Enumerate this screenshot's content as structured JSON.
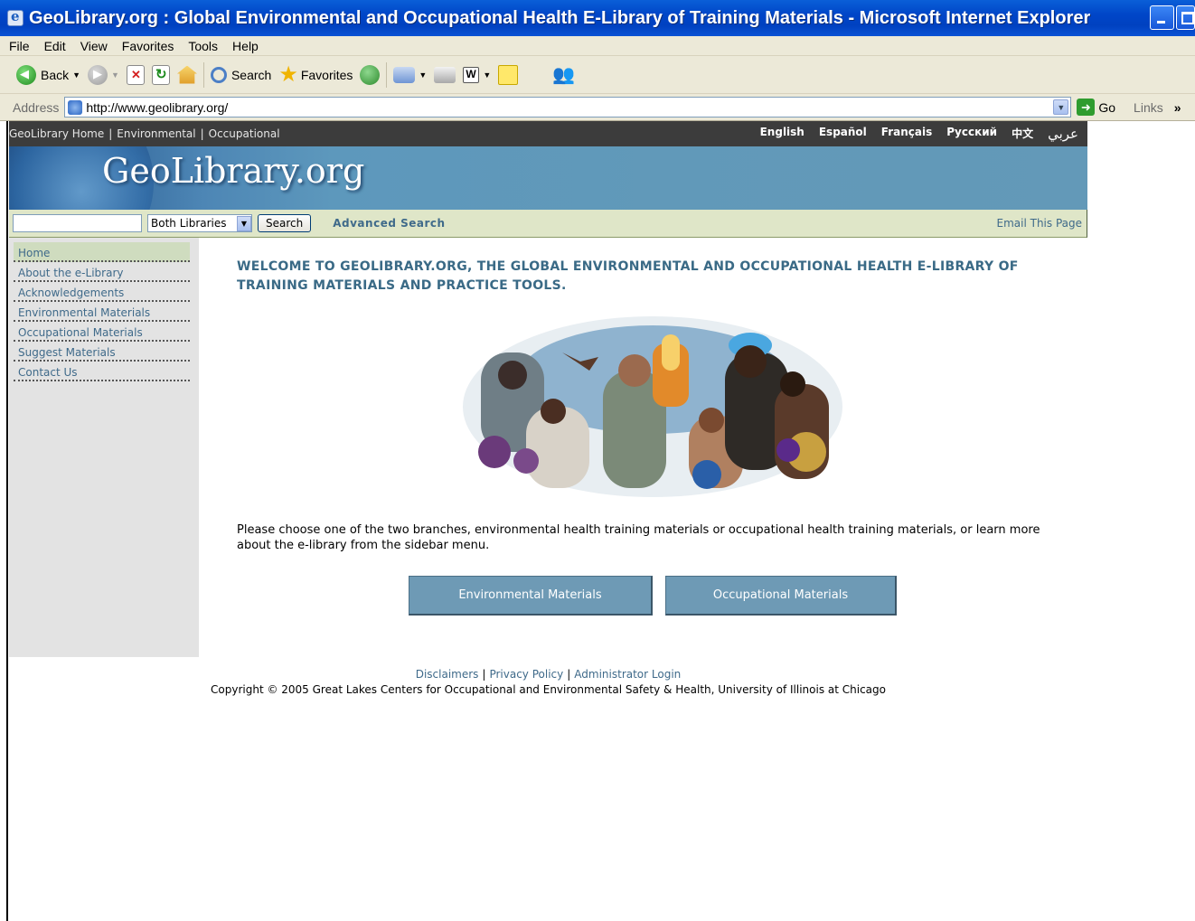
{
  "window": {
    "title": "GeoLibrary.org : Global Environmental and Occupational Health E-Library of Training Materials - Microsoft Internet Explorer"
  },
  "menu": [
    "File",
    "Edit",
    "View",
    "Favorites",
    "Tools",
    "Help"
  ],
  "toolbar": {
    "back_label": "Back",
    "search_label": "Search",
    "favorites_label": "Favorites"
  },
  "address": {
    "label": "Address",
    "url": "http://www.geolibrary.org/",
    "go_label": "Go",
    "links_label": "Links"
  },
  "site": {
    "crumbs": [
      "GeoLibrary Home",
      "Environmental",
      "Occupational"
    ],
    "languages": [
      "English",
      "Español",
      "Français",
      "Русский",
      "中文",
      "عربي"
    ],
    "logo": "GeoLibrary.org",
    "search": {
      "query": "",
      "scope": "Both Libraries",
      "button": "Search",
      "advanced": "Advanced Search",
      "email": "Email This Page"
    },
    "sidebar": [
      {
        "label": "Home",
        "active": true
      },
      {
        "label": "About the e-Library"
      },
      {
        "label": "Acknowledgements"
      },
      {
        "label": "Environmental Materials"
      },
      {
        "label": "Occupational Materials"
      },
      {
        "label": "Suggest Materials"
      },
      {
        "label": "Contact Us"
      }
    ],
    "welcome": "WELCOME TO GEOLIBRARY.ORG, THE GLOBAL ENVIRONMENTAL AND OCCUPATIONAL HEALTH E-LIBRARY OF TRAINING MATERIALS AND PRACTICE TOOLS.",
    "intro": "Please choose one of the two branches, environmental health training materials or occupational health training materials, or learn more about the e-library from the sidebar menu.",
    "buttons": {
      "environmental": "Environmental Materials",
      "occupational": "Occupational Materials"
    },
    "footer": {
      "links": [
        "Disclaimers",
        "Privacy Policy",
        "Administrator Login"
      ],
      "copyright": "Copyright © 2005 Great Lakes Centers for Occupational and Environmental Safety & Health, University of Illinois at Chicago"
    }
  }
}
